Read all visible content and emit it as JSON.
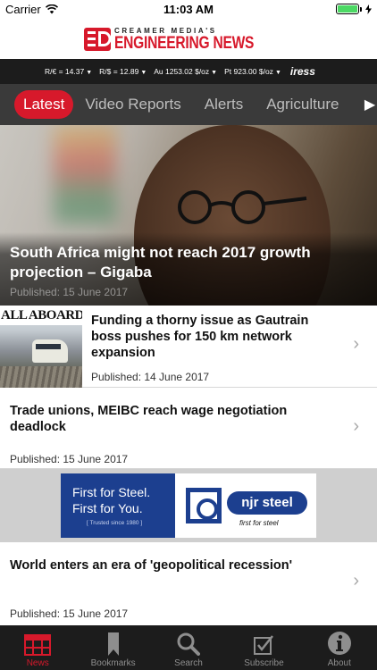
{
  "status_bar": {
    "carrier": "Carrier",
    "time": "11:03 AM",
    "battery_percent": 100
  },
  "brand": {
    "subtitle": "CREAMER MEDIA'S",
    "title": "ENGINEERING NEWS",
    "color": "#d7192b"
  },
  "ticker": {
    "items": [
      {
        "label": "R/€ = 14.37",
        "direction": "down"
      },
      {
        "label": "R/$ = 12.89",
        "direction": "down"
      },
      {
        "label": "Au 1253.02 $/oz",
        "direction": "down"
      },
      {
        "label": "Pt 923.00 $/oz",
        "direction": "down"
      }
    ],
    "provider": "iress"
  },
  "tabs": [
    {
      "label": "Latest",
      "active": true
    },
    {
      "label": "Video Reports",
      "active": false
    },
    {
      "label": "Alerts",
      "active": false
    },
    {
      "label": "Agriculture",
      "active": false
    }
  ],
  "hero": {
    "title": "South Africa might not reach 2017 growth projection – Gigaba",
    "date": "Published: 15 June 2017"
  },
  "articles": [
    {
      "title": "Funding a thorny issue as Gautrain boss pushes for 150 km network expansion",
      "date": "Published: 14 June 2017",
      "thumb_caption": "ALL ABOARD"
    },
    {
      "title": "Trade unions, MEIBC reach wage negotiation deadlock",
      "date": "Published: 15 June 2017"
    },
    {
      "title": "World enters an era of 'geopolitical recession'",
      "date": "Published: 15 June 2017"
    }
  ],
  "ad": {
    "line1": "First for Steel.",
    "line2": "First for You.",
    "line3": "[ Trusted since 1980 ]",
    "brand": "njr steel",
    "tagline": "first for steel"
  },
  "tabbar": [
    {
      "label": "News",
      "icon": "news-icon",
      "active": true
    },
    {
      "label": "Bookmarks",
      "icon": "bookmark-icon",
      "active": false
    },
    {
      "label": "Search",
      "icon": "search-icon",
      "active": false
    },
    {
      "label": "Subscribe",
      "icon": "subscribe-icon",
      "active": false
    },
    {
      "label": "About",
      "icon": "info-icon",
      "active": false
    }
  ]
}
